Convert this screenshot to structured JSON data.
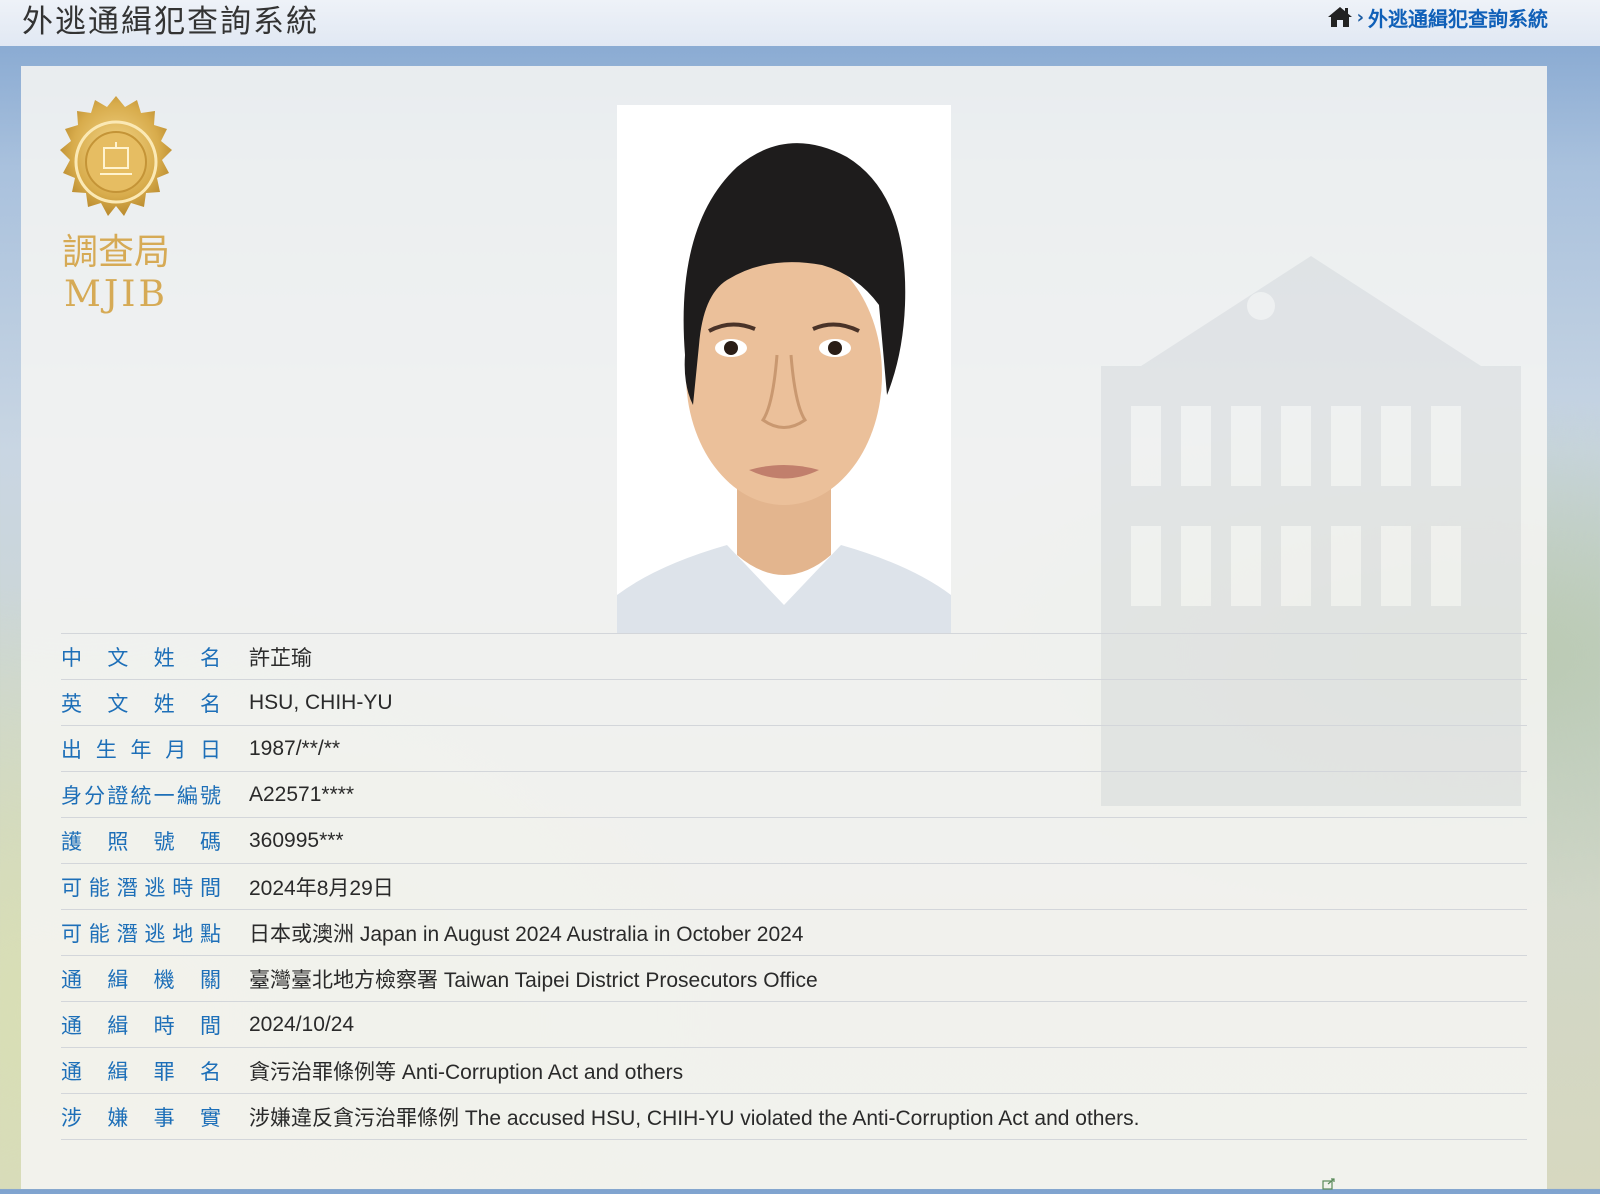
{
  "header": {
    "site_title": "外逃通緝犯查詢系統",
    "breadcrumb": {
      "home_icon": "home-icon",
      "separator": "›",
      "current": "外逃通緝犯查詢系統"
    }
  },
  "emblem": {
    "chinese_text": "調查局",
    "english_text": "MJIB"
  },
  "photo": {
    "alt": ""
  },
  "details": [
    {
      "label": "中文姓名",
      "value": "許芷瑜"
    },
    {
      "label": "英文姓名",
      "value": "HSU, CHIH-YU"
    },
    {
      "label": "出生年月日",
      "value": "1987/**/**"
    },
    {
      "label": "身分證統一編號",
      "value": "A22571****"
    },
    {
      "label": "護照號碼",
      "value": "360995***"
    },
    {
      "label": "可能潛逃時間",
      "value": "2024年8月29日"
    },
    {
      "label": "可能潛逃地點",
      "value": "日本或澳洲 Japan in August 2024 Australia in October 2024"
    },
    {
      "label": "通緝機關",
      "value": "臺灣臺北地方檢察署 Taiwan Taipei District Prosecutors Office"
    },
    {
      "label": "通緝時間",
      "value": "2024/10/24"
    },
    {
      "label": "通緝罪名",
      "value": "貪污治罪條例等 Anti-Corruption Act and others"
    },
    {
      "label": "涉嫌事實",
      "value": "涉嫌違反貪污治罪條例 The accused HSU, CHIH-YU violated the Anti-Corruption Act and others."
    }
  ],
  "footer": {
    "icon": "external-link-icon"
  }
}
